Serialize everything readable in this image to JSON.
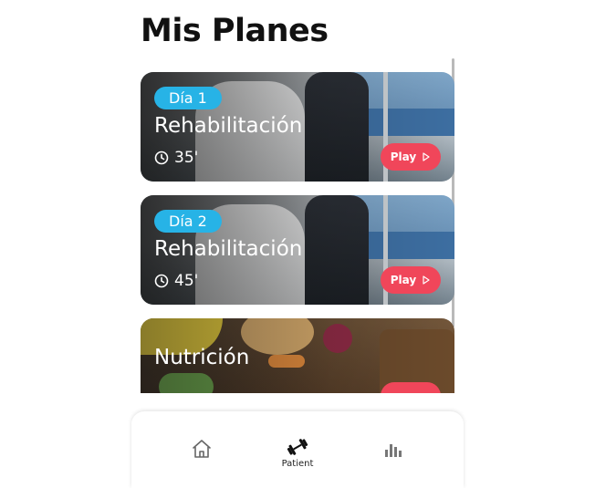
{
  "page": {
    "title": "Mis Planes"
  },
  "plans": [
    {
      "day": "Día 1",
      "name": "Rehabilitación",
      "duration": "35'",
      "play_label": "Play"
    },
    {
      "day": "Día 2",
      "name": "Rehabilitación",
      "duration": "45'",
      "play_label": "Play"
    },
    {
      "day": "",
      "name": "Nutrición",
      "duration": "",
      "play_label": ""
    }
  ],
  "nav": {
    "items": [
      {
        "icon": "home-icon",
        "label": ""
      },
      {
        "icon": "dumbbell-icon",
        "label": "Patient"
      },
      {
        "icon": "bar-chart-icon",
        "label": ""
      }
    ]
  },
  "colors": {
    "badge": "#27b3e6",
    "play": "#f0465a"
  }
}
